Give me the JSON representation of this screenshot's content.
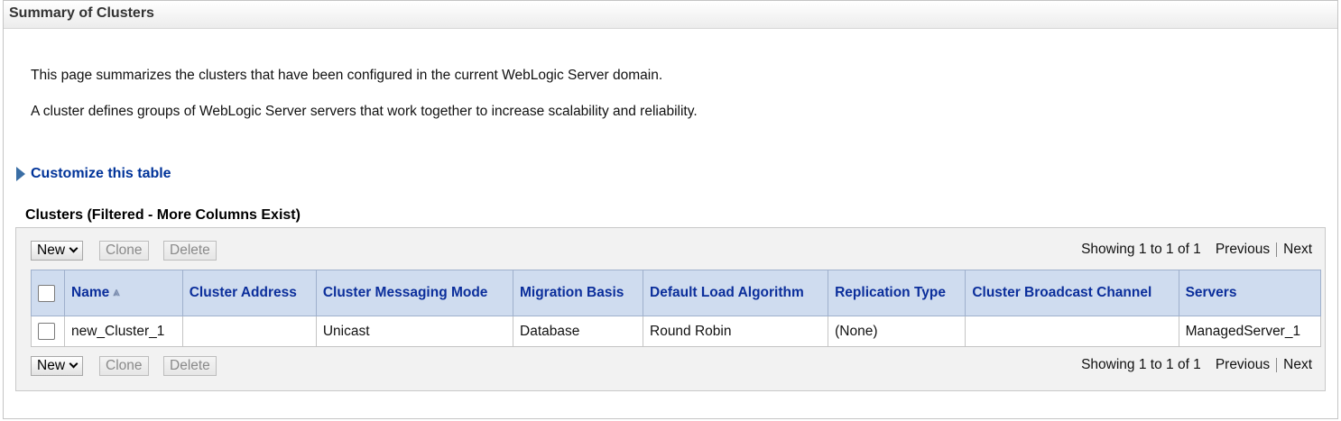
{
  "header": {
    "title": "Summary of Clusters"
  },
  "description": {
    "line1": "This page summarizes the clusters that have been configured in the current WebLogic Server domain.",
    "line2": "A cluster defines groups of WebLogic Server servers that work together to increase scalability and reliability."
  },
  "customize": {
    "label": "Customize this table"
  },
  "table_section": {
    "title": "Clusters (Filtered - More Columns Exist)"
  },
  "toolbar": {
    "new_label": "New",
    "clone_label": "Clone",
    "delete_label": "Delete",
    "showing": "Showing 1 to 1 of 1",
    "previous": "Previous",
    "next": "Next"
  },
  "columns": [
    "Name",
    "Cluster Address",
    "Cluster Messaging Mode",
    "Migration Basis",
    "Default Load Algorithm",
    "Replication Type",
    "Cluster Broadcast Channel",
    "Servers"
  ],
  "rows": [
    {
      "name": "new_Cluster_1",
      "cluster_address": "",
      "messaging_mode": "Unicast",
      "migration_basis": "Database",
      "load_algorithm": "Round Robin",
      "replication_type": "(None)",
      "broadcast_channel": "",
      "servers": "ManagedServer_1"
    }
  ],
  "colors": {
    "link": "#003399",
    "header_bg": "#cfdcef",
    "header_text": "#0b2e9b"
  }
}
